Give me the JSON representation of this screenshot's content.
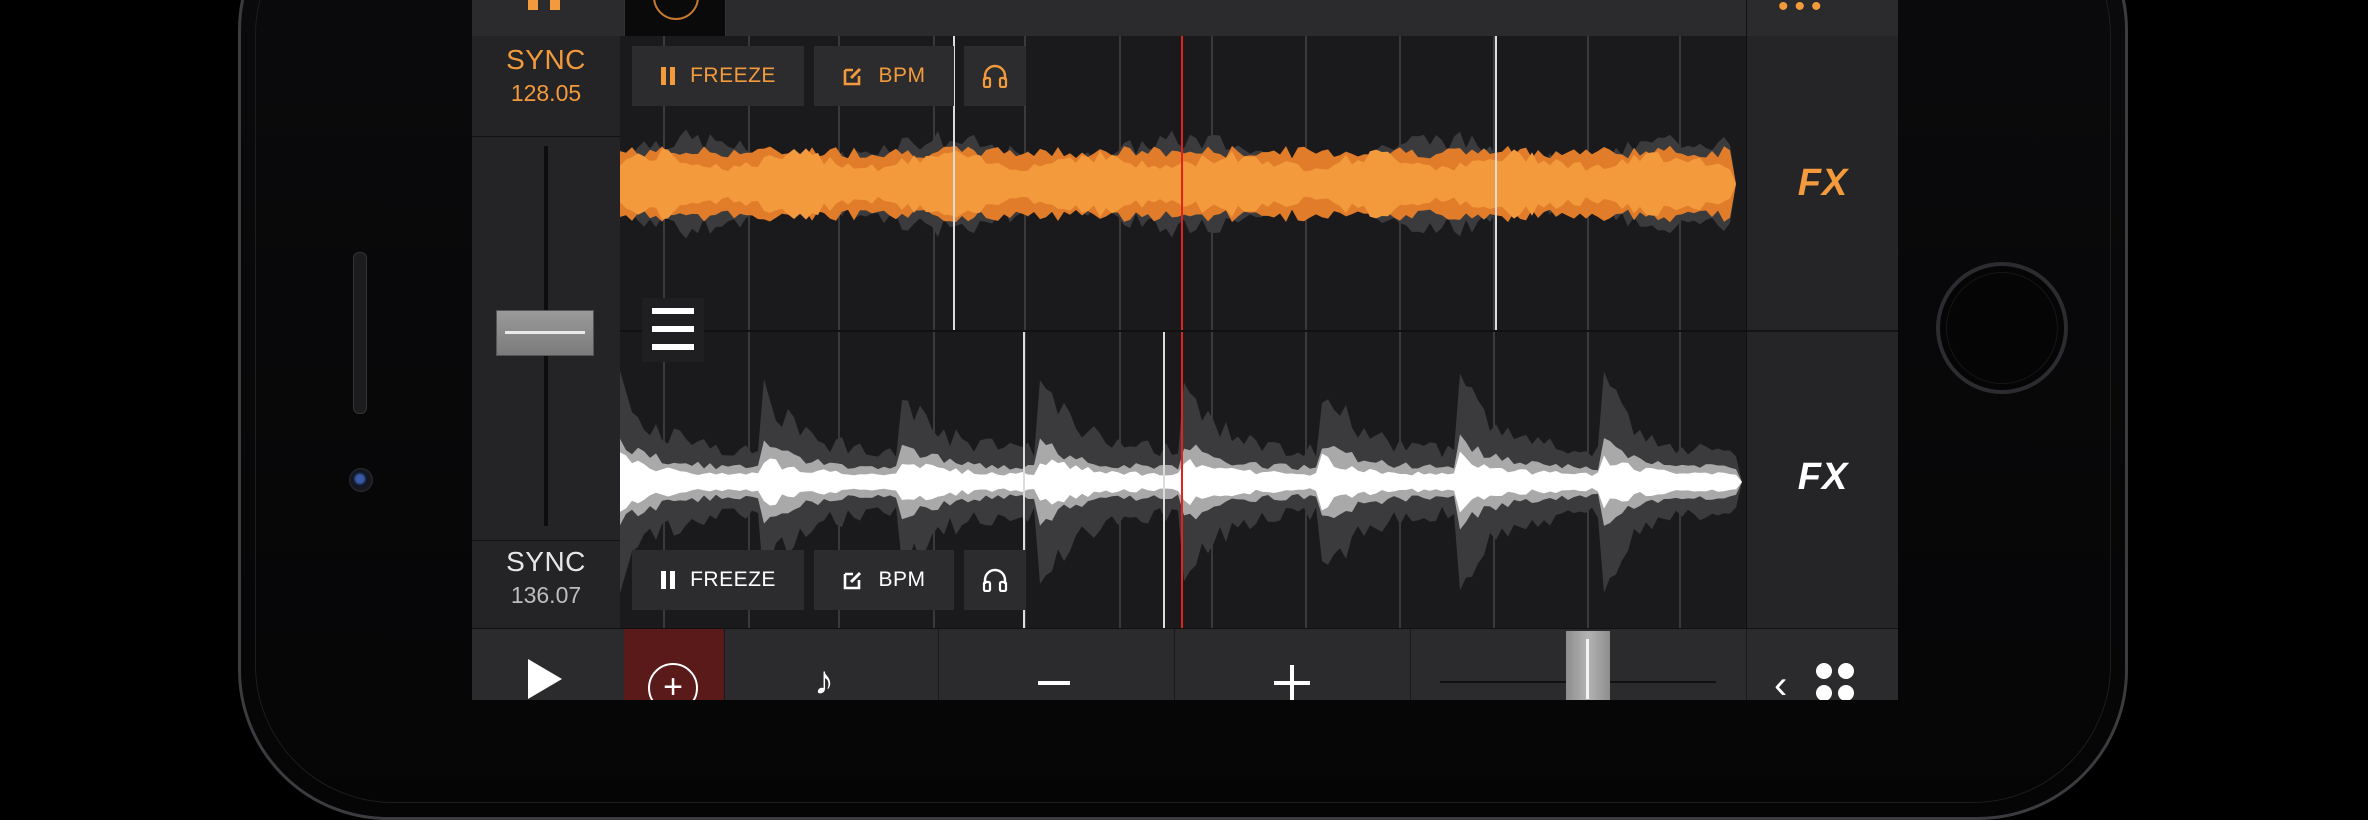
{
  "deck_a": {
    "sync_label": "SYNC",
    "bpm": "128.05",
    "freeze_label": "FREEZE",
    "bpm_button_label": "BPM",
    "fx_label": "FX",
    "waveform_color": "#f39a3c"
  },
  "deck_b": {
    "sync_label": "SYNC",
    "bpm": "136.07",
    "freeze_label": "FREEZE",
    "bpm_button_label": "BPM",
    "fx_label": "FX",
    "waveform_color": "#ffffff"
  },
  "colors": {
    "accent": "#f39a3c",
    "playhead": "#e0241b",
    "background": "#1d1d1f"
  },
  "icons": {
    "top_left": "pause-bars-icon",
    "menu": "hamburger-menu-icon",
    "freeze": "pause-icon",
    "bpm": "edit-icon",
    "headphones": "headphones-icon",
    "play": "play-icon",
    "add": "add-circle-icon",
    "note": "music-note-icon",
    "minus": "minus-icon",
    "plus": "plus-icon",
    "grid": "chevron-grid-icon"
  }
}
